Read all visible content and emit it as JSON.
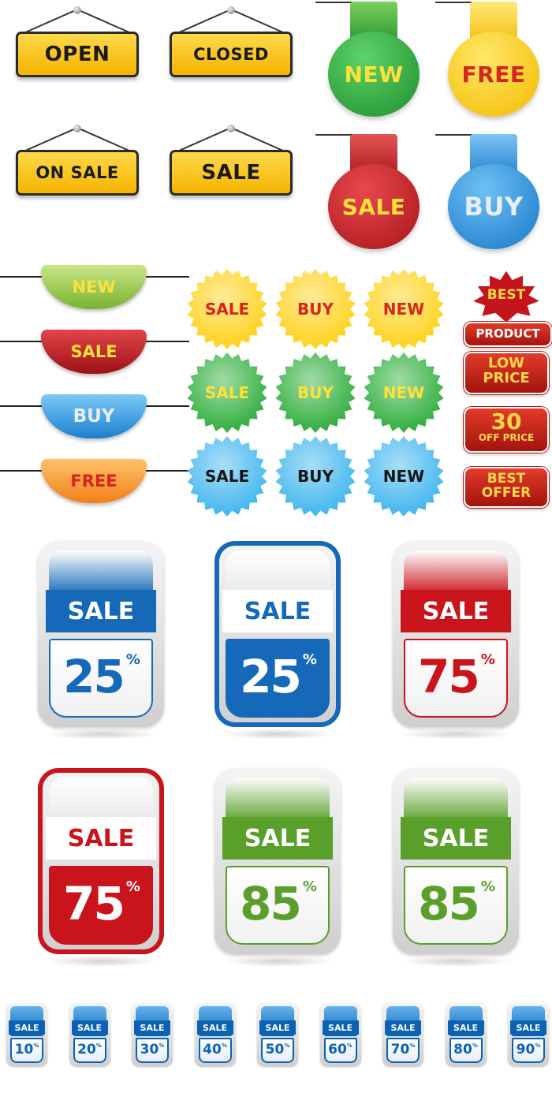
{
  "hanging_signs": [
    {
      "text": "OPEN"
    },
    {
      "text": "CLOSED"
    },
    {
      "text": "ON SALE"
    },
    {
      "text": "SALE"
    }
  ],
  "round_tags": [
    {
      "text": "NEW",
      "color": "#2fae3c",
      "text_color": "#ffe13a"
    },
    {
      "text": "FREE",
      "color": "#ffd21a",
      "text_color": "#d3261d"
    },
    {
      "text": "SALE",
      "color": "#d6252a",
      "text_color": "#ffe13a"
    },
    {
      "text": "BUY",
      "color": "#2b96e0",
      "text_color": "#e8eef4"
    }
  ],
  "half_tabs": [
    {
      "text": "NEW",
      "color": "#8ec63f",
      "text_color": "#ffe13a"
    },
    {
      "text": "SALE",
      "color": "#c91d22",
      "text_color": "#ffe13a"
    },
    {
      "text": "BUY",
      "color": "#2b8fd8",
      "text_color": "#e8eef4"
    },
    {
      "text": "FREE",
      "color": "#f7941d",
      "text_color": "#d3261d"
    }
  ],
  "starbursts": {
    "rows": [
      {
        "color": "#ffd21a",
        "text_color": "#d3261d",
        "items": [
          "SALE",
          "BUY",
          "NEW"
        ]
      },
      {
        "color": "#2fae3c",
        "text_color": "#ffe13a",
        "items": [
          "SALE",
          "BUY",
          "NEW"
        ]
      },
      {
        "color": "#3fb6ee",
        "text_color": "#151515",
        "items": [
          "SALE",
          "BUY",
          "NEW"
        ]
      }
    ]
  },
  "red_labels": {
    "best": "BEST",
    "product": "PRODUCT",
    "low_price_1": "LOW",
    "low_price_2": "PRICE",
    "thirty": "30",
    "off_price": "OFF PRICE",
    "best_offer_1": "BEST",
    "best_offer_2": "OFFER"
  },
  "sale_badges": [
    {
      "label": "SALE",
      "value": "25",
      "unit": "%",
      "color": "#1569b8",
      "style": "light"
    },
    {
      "label": "SALE",
      "value": "25",
      "unit": "%",
      "color": "#1569b8",
      "style": "dark"
    },
    {
      "label": "SALE",
      "value": "75",
      "unit": "%",
      "color": "#c9141b",
      "style": "light"
    },
    {
      "label": "SALE",
      "value": "75",
      "unit": "%",
      "color": "#c9141b",
      "style": "dark"
    },
    {
      "label": "SALE",
      "value": "85",
      "unit": "%",
      "color": "#5a9f2a",
      "style": "light"
    },
    {
      "label": "SALE",
      "value": "85",
      "unit": "%",
      "color": "#5a9f2a",
      "style": "dark"
    }
  ],
  "mini_badges": [
    {
      "label": "SALE",
      "value": "10",
      "unit": "%"
    },
    {
      "label": "SALE",
      "value": "20",
      "unit": "%"
    },
    {
      "label": "SALE",
      "value": "30",
      "unit": "%"
    },
    {
      "label": "SALE",
      "value": "40",
      "unit": "%"
    },
    {
      "label": "SALE",
      "value": "50",
      "unit": "%"
    },
    {
      "label": "SALE",
      "value": "60",
      "unit": "%"
    },
    {
      "label": "SALE",
      "value": "70",
      "unit": "%"
    },
    {
      "label": "SALE",
      "value": "80",
      "unit": "%"
    },
    {
      "label": "SALE",
      "value": "90",
      "unit": "%"
    }
  ]
}
